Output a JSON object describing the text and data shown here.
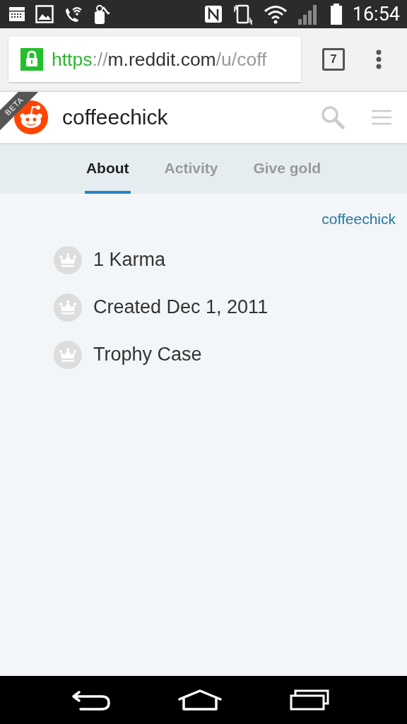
{
  "status_bar": {
    "time": "16:54"
  },
  "browser": {
    "url": {
      "scheme": "https",
      "separator": "://",
      "host": "m.reddit.com",
      "path": "/u/coff"
    },
    "secure": true,
    "tab_count": "7"
  },
  "header": {
    "badge": "BETA",
    "username": "coffeechick"
  },
  "tabs": [
    {
      "label": "About",
      "selected": true
    },
    {
      "label": "Activity",
      "selected": false
    },
    {
      "label": "Give gold",
      "selected": false
    }
  ],
  "profile": {
    "user_link": "coffeechick",
    "items": [
      {
        "text": "1 Karma"
      },
      {
        "text": "Created Dec 1, 2011"
      },
      {
        "text": "Trophy Case"
      }
    ]
  }
}
